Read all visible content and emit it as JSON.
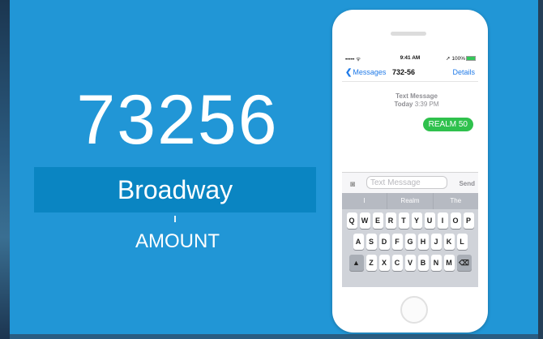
{
  "slide": {
    "shortcode": "73256",
    "keyword": "Broadway",
    "amount": "AMOUNT"
  },
  "phone": {
    "status": {
      "signal": "••••• ᯤ",
      "time": "9:41 AM",
      "battery": "➚ 100%"
    },
    "nav": {
      "back": "Messages",
      "title": "732-56",
      "details": "Details"
    },
    "meta": {
      "line1": "Text Message",
      "day": "Today",
      "time": "3:39 PM"
    },
    "message": "REALM 50",
    "input": {
      "placeholder": "Text Message",
      "send": "Send"
    },
    "suggestions": [
      "I",
      "Realm",
      "The"
    ],
    "keyboard": {
      "row1": [
        "Q",
        "W",
        "E",
        "R",
        "T",
        "Y",
        "U",
        "I",
        "O",
        "P"
      ],
      "row2": [
        "A",
        "S",
        "D",
        "F",
        "G",
        "H",
        "J",
        "K",
        "L"
      ],
      "row3": [
        "Z",
        "X",
        "C",
        "V",
        "B",
        "N",
        "M"
      ]
    }
  },
  "colors": {
    "slide_bg": "#2196d6",
    "keyword_bar": "#0a85c2",
    "bubble": "#2fc14d",
    "ios_blue": "#1f7ae8"
  },
  "icons": {
    "camera": "camera-icon",
    "back": "chevron-left-icon",
    "shift": "shift-icon",
    "delete": "delete-icon"
  }
}
